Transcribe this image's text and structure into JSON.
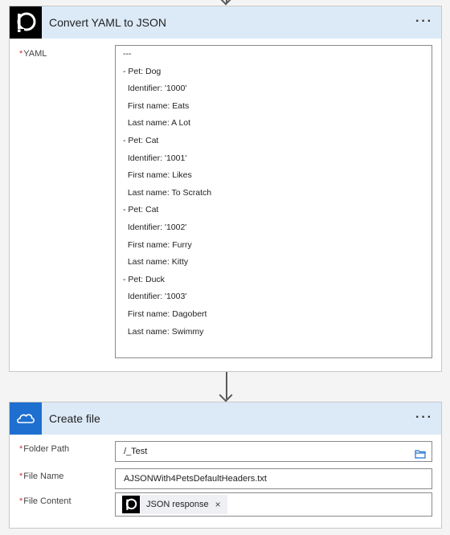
{
  "convert_card": {
    "title": "Convert YAML to JSON",
    "menu": "···",
    "yaml_label": "YAML",
    "required_mark": "*",
    "yaml_lines": [
      "---",
      "- Pet: Dog",
      "  Identifier: '1000'",
      "  First name: Eats",
      "  Last name: A Lot",
      "- Pet: Cat",
      "  Identifier: '1001'",
      "  First name: Likes",
      "  Last name: To Scratch",
      "- Pet: Cat",
      "  Identifier: '1002'",
      "  First name: Furry",
      "  Last name: Kitty",
      "- Pet: Duck",
      "  Identifier: '1003'",
      "  First name: Dagobert",
      "  Last name: Swimmy"
    ]
  },
  "create_card": {
    "title": "Create file",
    "menu": "···",
    "required_mark": "*",
    "folder_path_label": "Folder Path",
    "folder_path_value": "/_Test",
    "file_name_label": "File Name",
    "file_name_value": "AJSONWith4PetsDefaultHeaders.txt",
    "file_content_label": "File Content",
    "file_content_token": "JSON response",
    "token_remove": "×"
  },
  "colors": {
    "header_bg": "#dceaf7",
    "onedrive_blue": "#1e6fd0",
    "required_red": "#d13438"
  }
}
